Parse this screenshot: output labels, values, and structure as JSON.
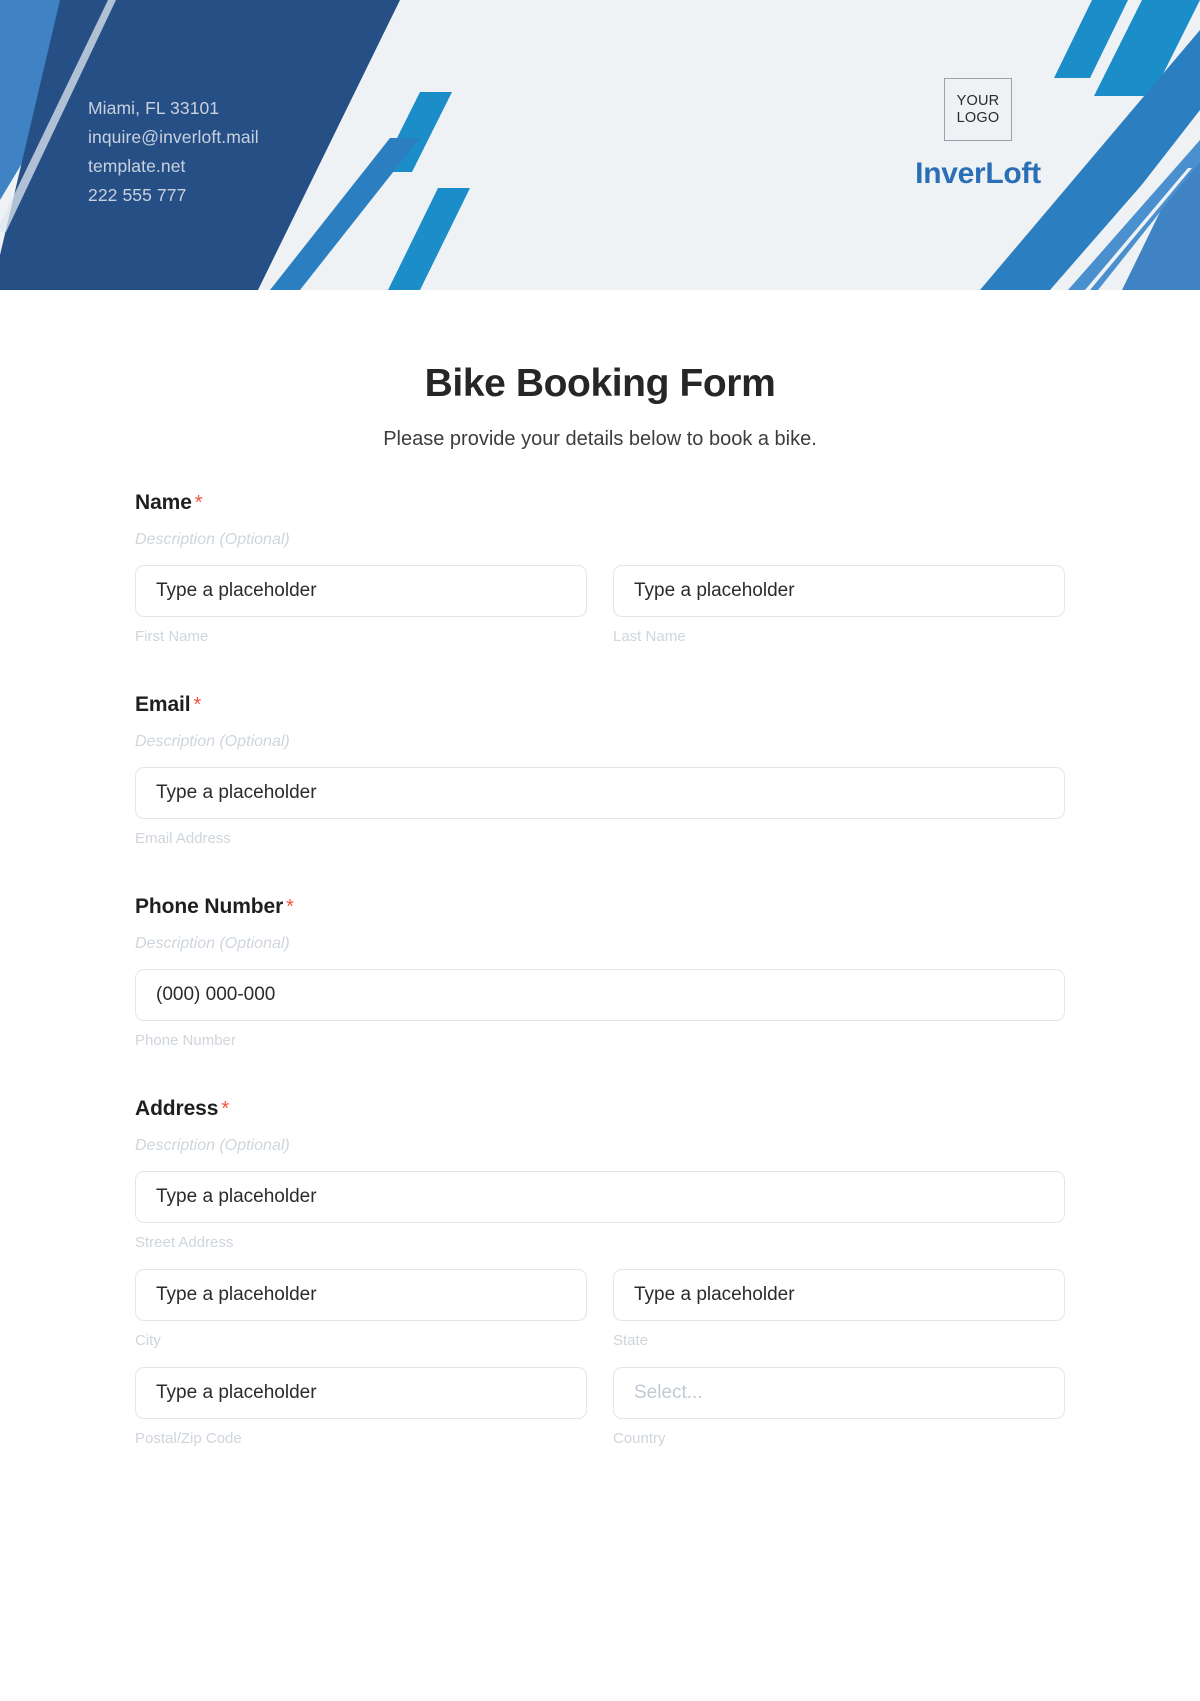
{
  "header": {
    "contact_lines": [
      "Miami, FL 33101",
      "inquire@inverloft.mail",
      "template.net",
      "222 555 777"
    ],
    "logo_line_1": "YOUR",
    "logo_line_2": "LOGO",
    "brand_name": "InverLoft",
    "colors": {
      "dark_blue": "#264f86",
      "mid_blue": "#3f83c4",
      "bright_blue": "#1b8dc9",
      "light_bg": "#eef2f5",
      "brand_text": "#2a6fb5"
    }
  },
  "form": {
    "title": "Bike Booking Form",
    "subtitle": "Please provide your details below to book a bike.",
    "required_marker": "*",
    "description_placeholder": "Description (Optional)",
    "fields": [
      {
        "label": "Name",
        "description": "Description (Optional)",
        "rows": [
          [
            {
              "placeholder": "Type a placeholder",
              "sub_label": "First Name",
              "type": "text"
            },
            {
              "placeholder": "Type a placeholder",
              "sub_label": "Last Name",
              "type": "text"
            }
          ]
        ]
      },
      {
        "label": "Email",
        "description": "Description (Optional)",
        "rows": [
          [
            {
              "placeholder": "Type a placeholder",
              "sub_label": "Email Address",
              "type": "text"
            }
          ]
        ]
      },
      {
        "label": "Phone Number",
        "description": "Description (Optional)",
        "rows": [
          [
            {
              "placeholder": "(000) 000-000",
              "sub_label": "Phone Number",
              "type": "tel"
            }
          ]
        ]
      },
      {
        "label": "Address",
        "description": "Description (Optional)",
        "rows": [
          [
            {
              "placeholder": "Type a placeholder",
              "sub_label": "Street Address",
              "type": "text"
            }
          ],
          [
            {
              "placeholder": "Type a placeholder",
              "sub_label": "City",
              "type": "text"
            },
            {
              "placeholder": "Type a placeholder",
              "sub_label": "State",
              "type": "text"
            }
          ],
          [
            {
              "placeholder": "Type a placeholder",
              "sub_label": "Postal/Zip Code",
              "type": "text"
            },
            {
              "placeholder": "Select...",
              "sub_label": "Country",
              "type": "select"
            }
          ]
        ]
      }
    ]
  }
}
